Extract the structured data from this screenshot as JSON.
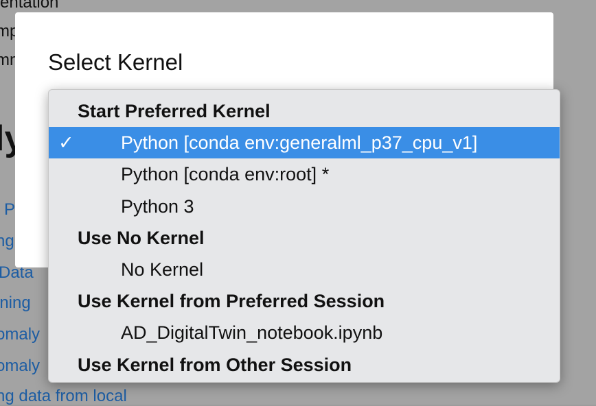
{
  "background": {
    "fragments": [
      "mentation",
      "mp",
      "mm",
      "ly",
      "l P",
      "ng",
      "Data",
      "ining",
      "omaly",
      "omaly",
      "ng data from local"
    ]
  },
  "dialog": {
    "title": "Select Kernel"
  },
  "menu": {
    "selected_color": "#3a8ee6",
    "rows": [
      {
        "type": "header",
        "label": "Start Preferred Kernel"
      },
      {
        "type": "item",
        "label": "Python [conda env:generalml_p37_cpu_v1]",
        "selected": true,
        "check": "✓"
      },
      {
        "type": "item",
        "label": "Python [conda env:root] *"
      },
      {
        "type": "item",
        "label": "Python 3"
      },
      {
        "type": "header",
        "label": "Use No Kernel"
      },
      {
        "type": "item",
        "label": "No Kernel"
      },
      {
        "type": "header",
        "label": "Use Kernel from Preferred Session"
      },
      {
        "type": "item",
        "label": "AD_DigitalTwin_notebook.ipynb"
      },
      {
        "type": "header",
        "label": "Use Kernel from Other Session"
      }
    ]
  }
}
